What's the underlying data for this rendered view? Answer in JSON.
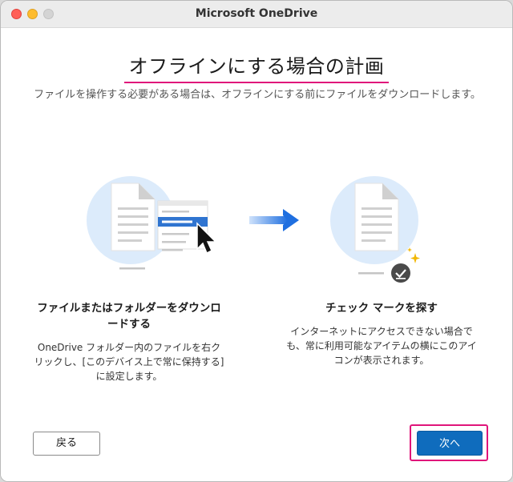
{
  "window": {
    "title": "Microsoft OneDrive"
  },
  "main": {
    "heading": "オフラインにする場合の計画",
    "subtitle": "ファイルを操作する必要がある場合は、オフラインにする前にファイルをダウンロードします。"
  },
  "steps": [
    {
      "title": "ファイルまたはフォルダーをダウンロードする",
      "description": "OneDrive フォルダー内のファイルを右クリックし、[このデバイス上で常に保持する] に設定します。"
    },
    {
      "title": "チェック マークを探す",
      "description": "インターネットにアクセスできない場合でも、常に利用可能なアイテムの横にこのアイコンが表示されます。"
    }
  ],
  "buttons": {
    "back": "戻る",
    "next": "次へ"
  },
  "colors": {
    "accent": "#0f6cbd",
    "highlight": "#e0157a",
    "illustration_bg": "#dcebfb"
  }
}
